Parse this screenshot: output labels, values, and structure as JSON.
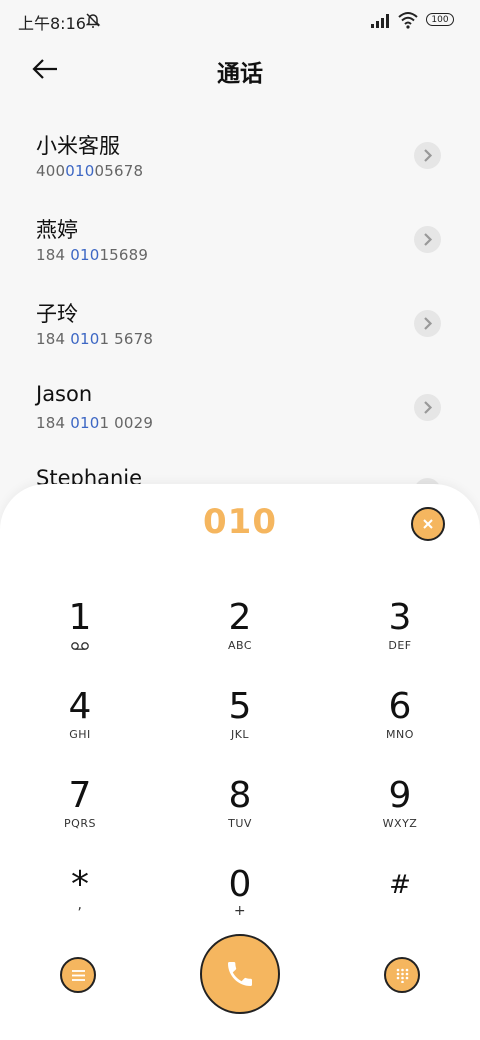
{
  "status": {
    "time": "上午8:16",
    "battery": "100"
  },
  "header": {
    "title": "通话"
  },
  "contacts": [
    {
      "name": "小米客服",
      "num_pre": "400",
      "num_hl": "010",
      "num_post": "05678"
    },
    {
      "name": "燕婷",
      "num_pre": "184 ",
      "num_hl": "010",
      "num_post": "15689"
    },
    {
      "name": "子玲",
      "num_pre": "184 ",
      "num_hl": "010",
      "num_post": "1 5678"
    },
    {
      "name": "Jason",
      "num_pre": "184 ",
      "num_hl": "010",
      "num_post": "1 0029"
    },
    {
      "name": "Stephanie",
      "num_pre": "",
      "num_hl": "",
      "num_post": ""
    }
  ],
  "dialpad": {
    "input": "010",
    "keys": [
      {
        "digit": "1",
        "letters": ""
      },
      {
        "digit": "2",
        "letters": "ABC"
      },
      {
        "digit": "3",
        "letters": "DEF"
      },
      {
        "digit": "4",
        "letters": "GHI"
      },
      {
        "digit": "5",
        "letters": "JKL"
      },
      {
        "digit": "6",
        "letters": "MNO"
      },
      {
        "digit": "7",
        "letters": "PQRS"
      },
      {
        "digit": "8",
        "letters": "TUV"
      },
      {
        "digit": "9",
        "letters": "WXYZ"
      },
      {
        "digit": "*",
        "letters": ","
      },
      {
        "digit": "0",
        "letters": "+"
      },
      {
        "digit": "#",
        "letters": ""
      }
    ]
  },
  "colors": {
    "accent": "#f5b65f",
    "highlight": "#3d67c4"
  },
  "icons": [
    "back-arrow-icon",
    "mute-icon",
    "signal-icon",
    "wifi-icon",
    "chevron-right-icon",
    "clear-icon",
    "menu-icon",
    "phone-icon",
    "dialpad-grid-icon",
    "voicemail-icon"
  ]
}
